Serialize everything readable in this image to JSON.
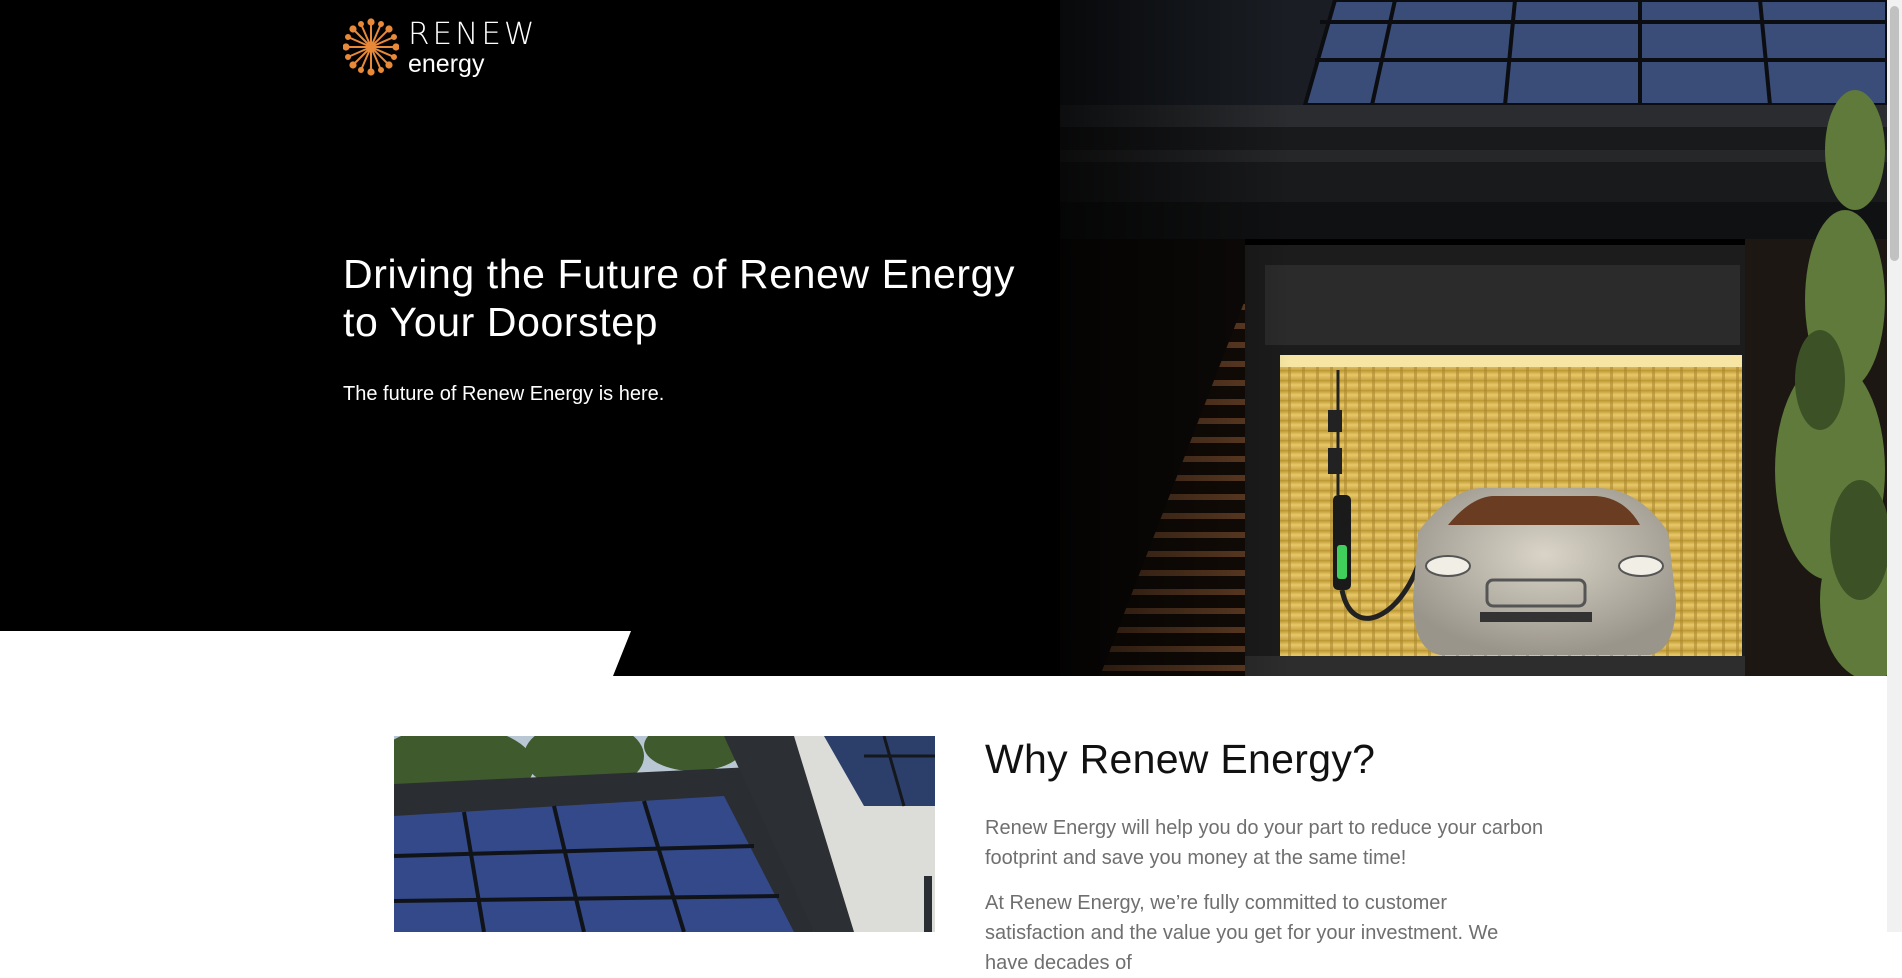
{
  "brand": {
    "name": "RENEW",
    "subtitle": "energy",
    "logo_icon": "sunburst-icon",
    "accent_color": "#e8893a"
  },
  "hero": {
    "title": "Driving the Future of Renew Energy to Your Doorstep",
    "subtitle": "The future of Renew Energy is here.",
    "background_color": "#000000"
  },
  "why": {
    "title": "Why Renew Energy?",
    "paragraph1": "Renew Energy will help you do your part to reduce your carbon footprint and save you money at the same time!",
    "paragraph2": "At Renew Energy, we’re fully committed to customer satisfaction and the value you get for your investment. We have decades of"
  }
}
